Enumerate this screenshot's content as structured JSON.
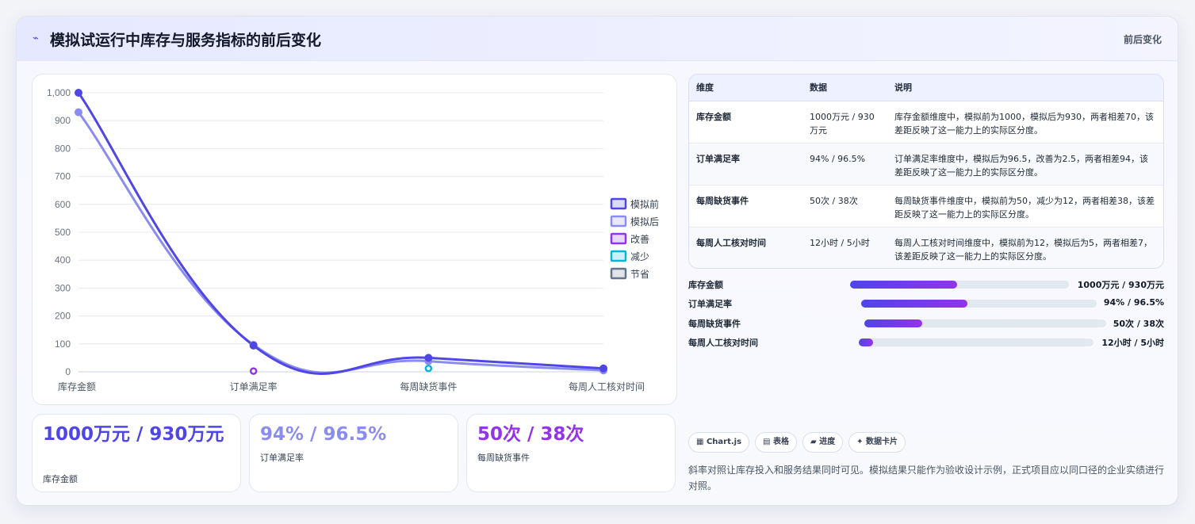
{
  "header": {
    "icon": "trend-icon",
    "title": "模拟试运行中库存与服务指标的前后变化",
    "tag": "前后变化"
  },
  "chart_data": {
    "type": "line",
    "categories": [
      "库存金额",
      "订单满足率",
      "每周缺货事件",
      "每周人工核对时间"
    ],
    "series": [
      {
        "name": "模拟前",
        "values": [
          1000,
          94,
          50,
          12
        ],
        "color": "#4f46e5"
      },
      {
        "name": "模拟后",
        "values": [
          930,
          96.5,
          38,
          5
        ],
        "color": "#8b8cf0"
      },
      {
        "name": "改善",
        "values": [
          null,
          2.5,
          null,
          null
        ],
        "color": "#9333ea"
      },
      {
        "name": "减少",
        "values": [
          null,
          null,
          12,
          null
        ],
        "color": "#06b6d4"
      },
      {
        "name": "节省",
        "values": [
          null,
          null,
          null,
          null
        ],
        "color": "#64748b"
      }
    ],
    "ylim": [
      0,
      1000
    ],
    "yticks": [
      0,
      100,
      200,
      300,
      400,
      500,
      600,
      700,
      800,
      900,
      1000
    ],
    "ytick_labels": [
      "0",
      "100",
      "200",
      "300",
      "400",
      "500",
      "600",
      "700",
      "800",
      "900",
      "1,000"
    ],
    "legend": "right",
    "grid": true
  },
  "stats": [
    {
      "value": "1000万元 / 930万元",
      "label": "库存金额",
      "color": "#4f46e5"
    },
    {
      "value": "94% / 96.5%",
      "label": "订单满足率",
      "color": "#8b8cf0"
    },
    {
      "value": "50次 / 38次",
      "label": "每周缺货事件",
      "color": "#9333ea"
    }
  ],
  "table": {
    "headers": [
      "维度",
      "数据",
      "说明"
    ],
    "rows": [
      [
        "库存金额",
        "1000万元 / 930万元",
        "库存金额维度中，模拟前为1000，模拟后为930，两者相差70，该差距反映了这一能力上的实际区分度。"
      ],
      [
        "订单满足率",
        "94% / 96.5%",
        "订单满足率维度中，模拟后为96.5，改善为2.5，两者相差94，该差距反映了这一能力上的实际区分度。"
      ],
      [
        "每周缺货事件",
        "50次 / 38次",
        "每周缺货事件维度中，模拟前为50，减少为12，两者相差38，该差距反映了这一能力上的实际区分度。"
      ],
      [
        "每周人工核对时间",
        "12小时 / 5小时",
        "每周人工核对时间维度中，模拟前为12，模拟后为5，两者相差7，该差距反映了这一能力上的实际区分度。"
      ]
    ]
  },
  "progress": [
    {
      "label": "库存金额",
      "value": "1000万元 / 930万元",
      "fraction": 0.49
    },
    {
      "label": "订单满足率",
      "value": "94% / 96.5%",
      "fraction": 0.45
    },
    {
      "label": "每周缺货事件",
      "value": "50次 / 38次",
      "fraction": 0.24
    },
    {
      "label": "每周人工核对时间",
      "value": "12小时 / 5小时",
      "fraction": 0.06
    }
  ],
  "chips": [
    {
      "icon": "chart-icon",
      "glyph": "▦",
      "label": "Chart.js"
    },
    {
      "icon": "table-icon",
      "glyph": "▤",
      "label": "表格"
    },
    {
      "icon": "progress-icon",
      "glyph": "▰",
      "label": "进度"
    },
    {
      "icon": "card-icon",
      "glyph": "✦",
      "label": "数据卡片"
    }
  ],
  "note": "斜率对照让库存投入和服务结果同时可见。模拟结果只能作为验收设计示例，正式项目应以同口径的企业实绩进行对照。"
}
